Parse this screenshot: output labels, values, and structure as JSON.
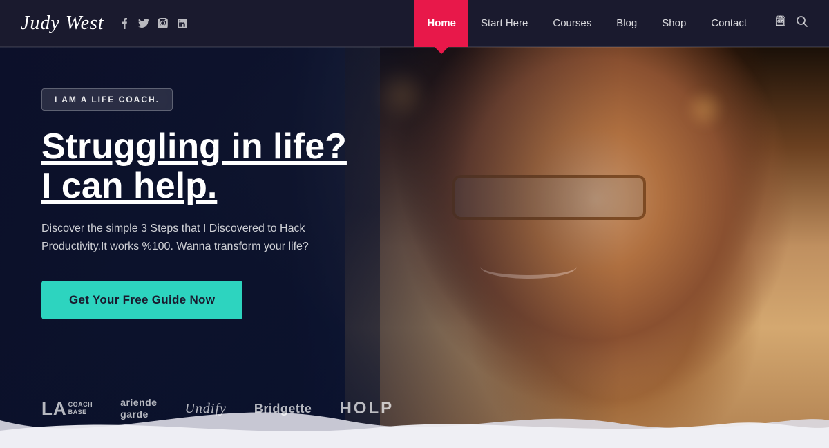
{
  "brand": {
    "name": "Judy West",
    "logo_text": "Judy West"
  },
  "social": {
    "icons": [
      "f",
      "t",
      "i",
      "in"
    ]
  },
  "nav": {
    "items": [
      {
        "label": "Home",
        "active": true
      },
      {
        "label": "Start Here",
        "active": false
      },
      {
        "label": "Courses",
        "active": false
      },
      {
        "label": "Blog",
        "active": false
      },
      {
        "label": "Shop",
        "active": false
      },
      {
        "label": "Contact",
        "active": false
      }
    ]
  },
  "hero": {
    "badge": "I AM A LIFE COACH.",
    "title": "Struggling in life?\nI can help.",
    "subtitle": "Discover the simple 3 Steps that I Discovered to Hack Productivity.It works %100. Wanna transform your life?",
    "cta_button": "Get Your Free Guide Now"
  },
  "logos": [
    {
      "text": "LA COACH BASE",
      "style": "split"
    },
    {
      "text": "ariende garde",
      "style": "two-line"
    },
    {
      "text": "Undify",
      "style": "script"
    },
    {
      "text": "Bridgette",
      "style": "normal"
    },
    {
      "text": "HOLP",
      "style": "bold"
    }
  ],
  "colors": {
    "nav_bg": "#1a1a2e",
    "accent_red": "#e8184a",
    "accent_teal": "#2dd4bf",
    "text_white": "#ffffff",
    "text_muted": "rgba(255,255,255,0.7)"
  }
}
